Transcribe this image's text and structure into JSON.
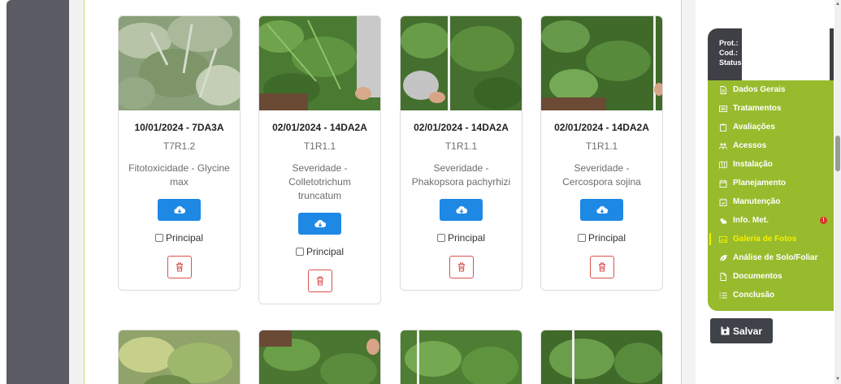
{
  "cards": [
    {
      "title": "10/01/2024 - 7DA3A",
      "code": "T7R1.2",
      "desc": "Fitotoxicidade - Glycine max",
      "principal": "Principal"
    },
    {
      "title": "02/01/2024 - 14DA2A",
      "code": "T1R1.1",
      "desc": "Severidade - Colletotrichum truncatum",
      "principal": "Principal"
    },
    {
      "title": "02/01/2024 - 14DA2A",
      "code": "T1R1.1",
      "desc": "Severidade - Phakopsora pachyrhizi",
      "principal": "Principal"
    },
    {
      "title": "02/01/2024 - 14DA2A",
      "code": "T1R1.1",
      "desc": "Severidade - Cercospora sojina",
      "principal": "Principal"
    }
  ],
  "sidebar": {
    "header": {
      "prot": "Prot.:",
      "cod": "Cod.:",
      "status": "Status:"
    },
    "items": [
      {
        "label": "Dados Gerais",
        "icon": "file-icon"
      },
      {
        "label": "Tratamentos",
        "icon": "list-icon"
      },
      {
        "label": "Avaliações",
        "icon": "clipboard-icon"
      },
      {
        "label": "Acessos",
        "icon": "users-icon"
      },
      {
        "label": "Instalação",
        "icon": "map-icon"
      },
      {
        "label": "Planejamento",
        "icon": "calendar-icon"
      },
      {
        "label": "Manutenção",
        "icon": "calendar-check-icon"
      },
      {
        "label": "Info. Met.",
        "icon": "weather-icon",
        "warning": "!"
      },
      {
        "label": "Galeria de Fotos",
        "icon": "image-icon",
        "active": true
      },
      {
        "label": "Análise de Solo/Foliar",
        "icon": "leaf-icon"
      },
      {
        "label": "Documentos",
        "icon": "document-icon"
      },
      {
        "label": "Conclusão",
        "icon": "checklist-icon"
      }
    ]
  },
  "save_label": "Salvar",
  "colors": {
    "accent_green": "#98bb2e",
    "active_yellow": "#f4f000",
    "download_blue": "#1e88e5",
    "delete_red": "#d9534f",
    "dark": "#3f3f46"
  }
}
